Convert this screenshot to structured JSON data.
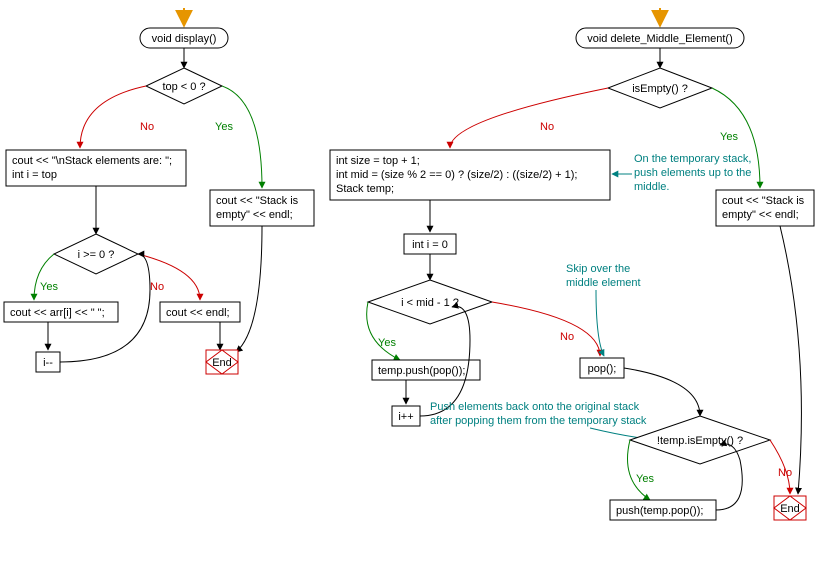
{
  "left": {
    "start": "void display()",
    "dec_top": "top < 0 ?",
    "box_no": [
      "cout << \"\\nStack elements are: \";",
      "int i = top"
    ],
    "box_yes": [
      "cout << \"Stack is",
      "empty\" << endl;"
    ],
    "dec_loop": "i >= 0 ?",
    "box_print": "cout << arr[i] << \" \";",
    "box_iminus": "i--",
    "box_endl": "cout << endl;",
    "end": "End"
  },
  "right": {
    "start": "void delete_Middle_Element()",
    "dec_isempty": "isEmpty() ?",
    "box_init": [
      "int size = top + 1;",
      "int mid = (size % 2 == 0) ? (size/2) : ((size/2) + 1);",
      "Stack temp;"
    ],
    "box_empty": [
      "cout << \"Stack is",
      "empty\" << endl;"
    ],
    "box_i0": "int i = 0",
    "dec_mid": "i < mid - 1 ?",
    "box_push": "temp.push(pop());",
    "box_ipp": "i++",
    "box_pop": "pop();",
    "dec_temp": "!temp.isEmpty() ?",
    "box_pushback": "push(temp.pop());",
    "end": "End",
    "comment1": [
      "On the temporary stack,",
      "push elements up to the",
      "middle."
    ],
    "comment2": [
      "Skip over the",
      "middle element"
    ],
    "comment3": [
      "Push elements back onto the original stack",
      "after popping them from the temporary stack"
    ]
  },
  "labels": {
    "yes": "Yes",
    "no": "No"
  }
}
